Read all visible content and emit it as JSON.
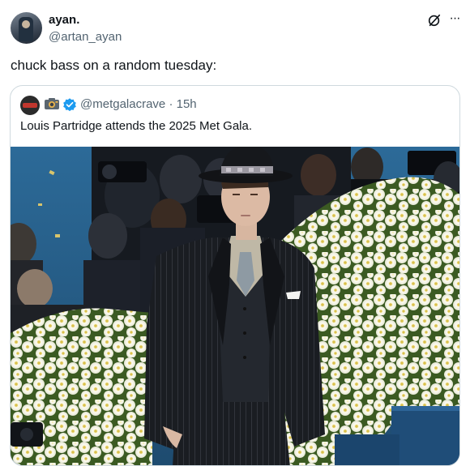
{
  "post": {
    "author": {
      "display_name": "ayan.",
      "handle": "@artan_ayan"
    },
    "text": "chuck bass on a random tuesday:",
    "icons": [
      "grok-icon",
      "more-icon"
    ],
    "more_label": "···"
  },
  "quote": {
    "author": {
      "handle": "@metgalacrave",
      "time_separator": "·",
      "time": "15h",
      "emoji": "camera-icon",
      "verified": true
    },
    "text": "Louis Partridge attends the 2025 Met Gala.",
    "media": {
      "subject": "man in black pinstripe suit and fedora in front of white flower wall"
    }
  },
  "colors": {
    "text_primary": "#0f1419",
    "text_secondary": "#536471",
    "border": "#cfd9de",
    "verified_blue": "#1d9bf0"
  }
}
